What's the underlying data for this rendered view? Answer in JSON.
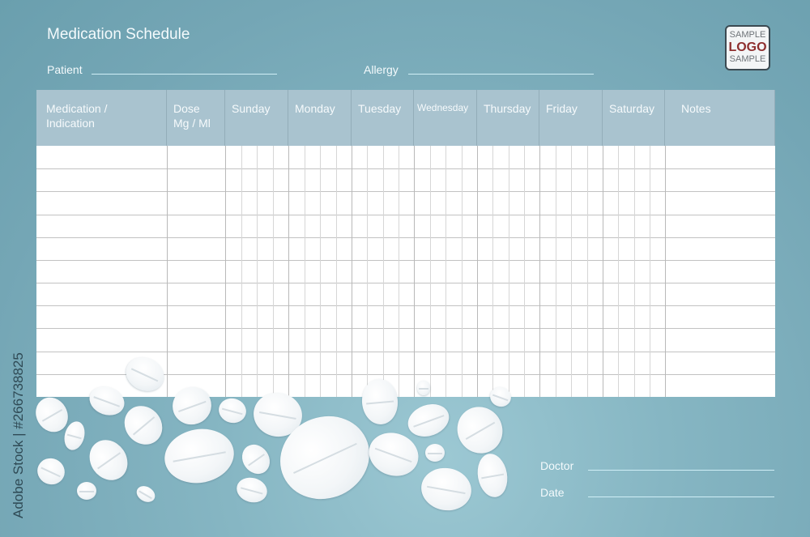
{
  "header": {
    "title": "Medication Schedule",
    "patient_label": "Patient",
    "patient_value": "",
    "allergy_label": "Allergy",
    "allergy_value": ""
  },
  "logo": {
    "top": "SAMPLE",
    "middle": "LOGO",
    "bottom": "SAMPLE",
    "accent_color": "#8e2f2f"
  },
  "table": {
    "columns": [
      {
        "label_line1": "Medication /",
        "label_line2": "Indication"
      },
      {
        "label_line1": "Dose",
        "label_line2": "Mg / Ml"
      },
      {
        "label_line1": "Sunday",
        "label_line2": ""
      },
      {
        "label_line1": "Monday",
        "label_line2": ""
      },
      {
        "label_line1": "Tuesday",
        "label_line2": ""
      },
      {
        "label_line1": "Wednesday",
        "label_line2": ""
      },
      {
        "label_line1": "Thursday",
        "label_line2": ""
      },
      {
        "label_line1": "Friday",
        "label_line2": ""
      },
      {
        "label_line1": "Saturday",
        "label_line2": ""
      },
      {
        "label_line1": "Notes",
        "label_line2": ""
      }
    ],
    "row_count": 11,
    "day_subcolumns": 4,
    "header_color": "#a9c3cf"
  },
  "footer": {
    "doctor_label": "Doctor",
    "doctor_value": "",
    "date_label": "Date",
    "date_value": ""
  },
  "watermark": {
    "text": "Adobe Stock | #266738825"
  },
  "colors": {
    "background": "#7eb0be",
    "text": "#f4fafc"
  }
}
